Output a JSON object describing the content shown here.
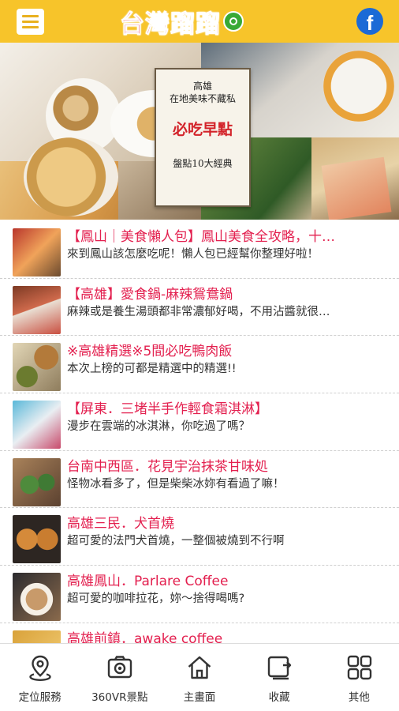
{
  "header": {
    "menu_icon": "hamburger-menu-icon",
    "logo_text": "台灣蹓蹓",
    "social_icon": "facebook-icon",
    "social_glyph": "f",
    "colors": {
      "bar": "#f7c42a",
      "logo": "#e8272c",
      "facebook": "#1b6ad6"
    }
  },
  "banner": {
    "sign_line1": "高雄",
    "sign_line2": "在地美味不藏私",
    "sign_title": "必吃早點",
    "sign_footer": "盤點10大經典",
    "prev_glyph": "‹",
    "next_glyph": "›",
    "slide_count": 8,
    "active_slide": 0
  },
  "articles": [
    {
      "title": "【鳳山｜美食懶人包】鳳山美食全攻略，十…",
      "subtitle": "來到鳳山該怎麼吃呢！懶人包已經幫你整理好啦！"
    },
    {
      "title": "【高雄】愛食鍋-麻辣鴛鴦鍋",
      "subtitle": "麻辣或是養生湯頭都非常濃郁好喝，不用沾醬就很…"
    },
    {
      "title": "※高雄精選※5間必吃鴨肉飯",
      "subtitle": "本次上榜的可都是精選中的精選!!"
    },
    {
      "title": "【屏東．三堵半手作輕食霜淇淋】",
      "subtitle": "漫步在雲端的冰淇淋，你吃過了嗎？"
    },
    {
      "title": "台南中西區．花見宇治抹茶甘味処",
      "subtitle": "怪物冰看多了，但是柴柴冰妳有看過了嘛！"
    },
    {
      "title": "高雄三民．犬首燒",
      "subtitle": "超可愛的法門犬首燒，一整個被燒到不行啊"
    },
    {
      "title": "高雄鳳山．Parlare Coffee",
      "subtitle": "超可愛的咖啡拉花，妳～捨得喝嗎?"
    },
    {
      "title": "高雄前鎮．awake coffee",
      "subtitle": ""
    }
  ],
  "tabbar": {
    "items": [
      {
        "label": "定位服務",
        "icon": "location-pin-icon"
      },
      {
        "label": "360VR景點",
        "icon": "camera-icon"
      },
      {
        "label": "主畫面",
        "icon": "home-icon"
      },
      {
        "label": "收藏",
        "icon": "bookmark-share-icon"
      },
      {
        "label": "其他",
        "icon": "grid-icon"
      }
    ]
  }
}
